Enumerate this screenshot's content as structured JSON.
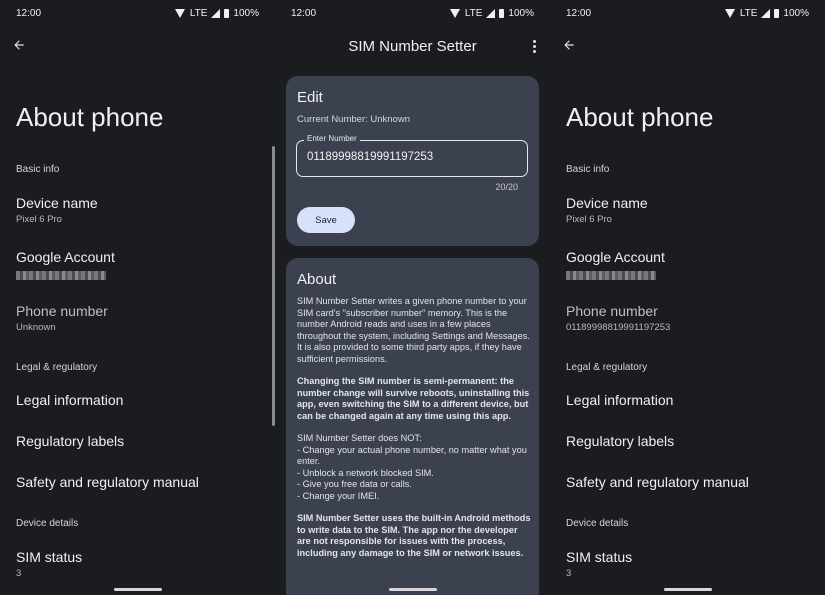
{
  "status": {
    "time": "12:00",
    "network": "LTE",
    "battery": "100%"
  },
  "about_phone": {
    "title": "About phone",
    "basic_info": "Basic info",
    "device_name": {
      "label": "Device name",
      "value": "Pixel 6 Pro"
    },
    "google_account": {
      "label": "Google Account"
    },
    "phone_number": {
      "label": "Phone number"
    },
    "legal_regulatory": "Legal & regulatory",
    "legal_information": "Legal information",
    "regulatory_labels": "Regulatory labels",
    "safety_manual": "Safety and regulatory manual",
    "device_details": "Device details",
    "sim_status": {
      "label": "SIM status",
      "value": "3"
    }
  },
  "left_phone_number_value": "Unknown",
  "right_phone_number_value": "01189998819991197253",
  "app": {
    "title": "SIM Number Setter",
    "edit": {
      "heading": "Edit",
      "current_number": "Current Number: Unknown",
      "field_label": "Enter Number",
      "field_value": "01189998819991197253",
      "counter": "20/20",
      "save_label": "Save"
    },
    "about": {
      "heading": "About",
      "p1": "SIM Number Setter writes a given phone number to your SIM card's \"subscriber number\" memory. This is the number Android reads and uses in a few places throughout the system, including Settings and Messages. It is also provided to some third party apps, if they have sufficient permissions.",
      "p2": "Changing the SIM number is semi-permanent: the number change will survive reboots, uninstalling this app, even switching the SIM to a different device, but can be changed again at any time using this app.",
      "p3_title": "SIM Number Setter does NOT:",
      "p3_items": [
        "- Change your actual phone number, no matter what you enter.",
        "- Unblock a network blocked SIM.",
        "- Give you free data or calls.",
        "- Change your IMEI."
      ],
      "p4": "SIM Number Setter uses the built-in Android methods to write data to the SIM. The app nor the developer are not responsible for issues with the process, including any damage to the SIM or network issues."
    }
  },
  "icons": {
    "back": "back-arrow-icon",
    "overflow": "more-vert-icon"
  }
}
